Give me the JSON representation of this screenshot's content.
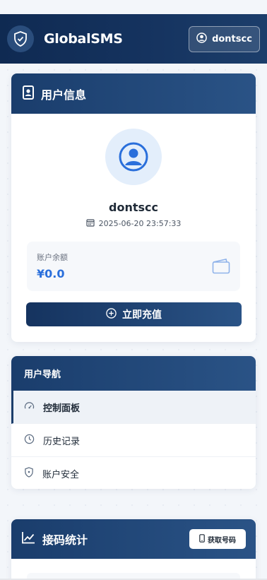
{
  "navbar": {
    "brand": "GlobalSMS",
    "user_button_label": "dontscc"
  },
  "user_info": {
    "header_title": "用户信息",
    "username": "dontscc",
    "registered_at": "2025-06-20 23:57:33",
    "balance_label": "账户余额",
    "balance_value": "¥0.0",
    "recharge_label": "立即充值"
  },
  "user_nav": {
    "header_title": "用户导航",
    "items": [
      {
        "label": "控制面板",
        "icon": "dashboard-icon",
        "active": true
      },
      {
        "label": "历史记录",
        "icon": "clock-icon",
        "active": false
      },
      {
        "label": "账户安全",
        "icon": "shield-icon",
        "active": false
      }
    ]
  },
  "stats": {
    "header_title": "接码统计",
    "get_number_label": "获取号码"
  },
  "colors": {
    "navbar": "#15335f",
    "accent": "#2a6fdb",
    "avatar_bg": "#e3eefb"
  }
}
